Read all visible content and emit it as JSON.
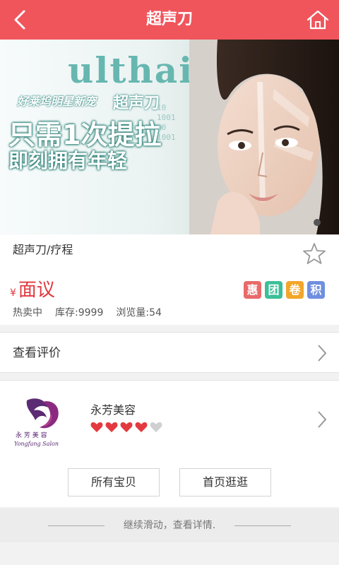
{
  "header": {
    "title": "超声刀",
    "back_icon": "back-arrow-icon",
    "home_icon": "home-icon",
    "bg_color": "#f0555c"
  },
  "banner": {
    "brand_text": "ulthaie",
    "subtitle_left": "好莱坞明星新宠",
    "subtitle_right": "超声刀",
    "headline_1": "只需1次提拉",
    "headline_2": "即刻拥有年轻",
    "numbers": [
      "10",
      "1001",
      "10",
      "1001"
    ]
  },
  "product": {
    "name": "超声刀/疗程",
    "currency": "¥",
    "price": "面议",
    "price_color": "#e0393e",
    "tags": [
      {
        "text": "惠",
        "color": "#e86a6a"
      },
      {
        "text": "团",
        "color": "#3cbf98"
      },
      {
        "text": "卷",
        "color": "#f2a62a"
      },
      {
        "text": "积",
        "color": "#6f8fe0"
      }
    ],
    "status": "热卖中",
    "stock": "库存:9999",
    "views": "浏览量:54"
  },
  "review": {
    "label": "查看评价"
  },
  "shop": {
    "name": "永芳美容",
    "logo_text_cn": "永 芳 美 容",
    "logo_text_en": "Yongfang Salon",
    "rating": 4,
    "rating_max": 5,
    "all_items_label": "所有宝贝",
    "home_label": "首页逛逛"
  },
  "footer": {
    "hint": "继续滑动，查看详情."
  }
}
